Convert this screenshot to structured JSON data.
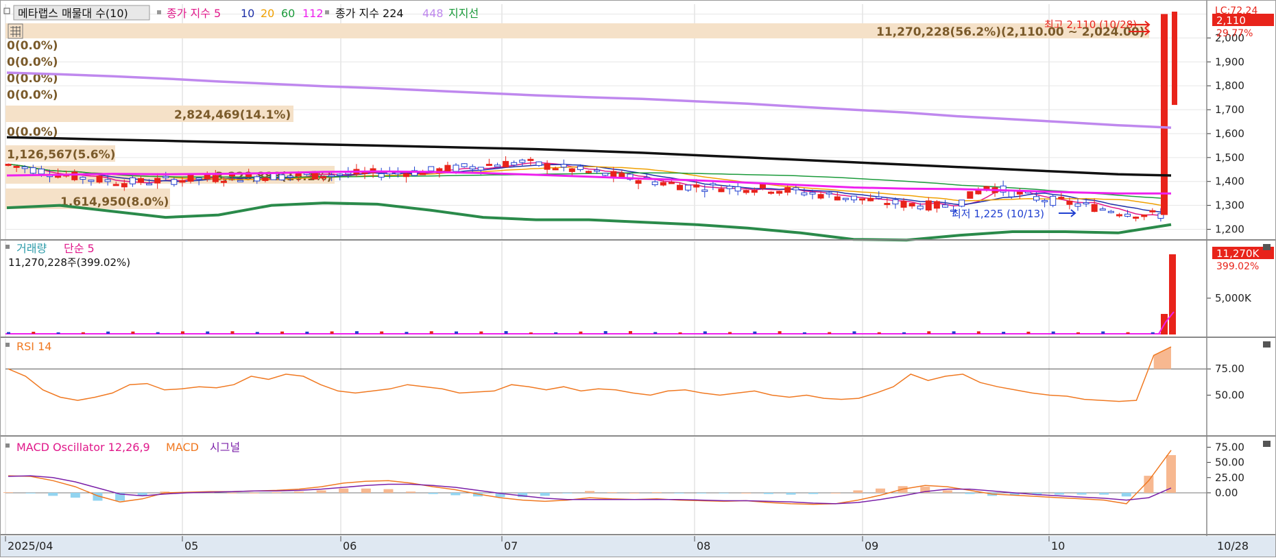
{
  "legend": {
    "stock_name": "메타랩스 매물대 수(10)",
    "ma_group_label": "종가 지수 5",
    "ma_10": "10",
    "ma_20": "20",
    "ma_60": "60",
    "ma_112": "112",
    "ma2_group_label": "종가 지수 224",
    "ma_448": "448",
    "support_line": "지지선",
    "volume_label": "거래량",
    "volume_ma": "단순 5",
    "volume_info": "11,270,228주(399.02%)",
    "rsi_label": "RSI 14",
    "macd_osc_label": "MACD Oscillator 12,26,9",
    "macd_label": "MACD",
    "signal_label": "시그널"
  },
  "annotations": {
    "high_text": "최고 2,110 (10/28)",
    "low_text": "최저 1,225 (10/13)",
    "top_profile": "11,270,228(56.2%)(2,110.00 ~ 2,024.00)",
    "price_box_label": "2,110",
    "change_pct": "29.77%",
    "lc_label": "LC:72.24",
    "vol_box_label": "11,270K",
    "vol_pct": "399.02%"
  },
  "colors": {
    "up": "#e8231a",
    "down": "#1f3fd0",
    "ma5": "#e0188a",
    "ma10": "#1c2fa8",
    "ma20": "#f0a000",
    "ma60": "#1a9a3a",
    "ma112": "#ee20ee",
    "ma224": "#111111",
    "ma448": "#bf88ee",
    "support": "#2a8a4a",
    "rsi": "#f07820",
    "macd": "#f07820",
    "signal": "#7a1fa8",
    "osc_pos": "#f7b890",
    "osc_neg": "#92d4f0",
    "profile": "#f5e1c8"
  },
  "chart_data": [
    {
      "type": "line",
      "panel": "price",
      "x_ticks": [
        "2025/04",
        "05",
        "06",
        "07",
        "08",
        "09",
        "10",
        "10/28"
      ],
      "y_ticks": [
        1200,
        1300,
        1400,
        1500,
        1600,
        1700,
        1800,
        1900,
        2000,
        2100
      ],
      "y_tick_labels": [
        "1,200",
        "1,300",
        "1,400",
        "1,500",
        "1,600",
        "1,700",
        "1,800",
        "1,900",
        "2,000",
        "2,110"
      ],
      "ylim": [
        1170,
        2130
      ],
      "highest": 2110,
      "lowest": 1225,
      "last_close": 2110,
      "change_pct": 29.77,
      "volume_profile": [
        {
          "label": "11,270,228(56.2%)(2,110.00 ~ 2,024.00)",
          "pct": 56.2
        },
        {
          "label": "0(0.0%)",
          "pct": 0.0
        },
        {
          "label": "0(0.0%)",
          "pct": 0.0
        },
        {
          "label": "0(0.0%)",
          "pct": 0.0
        },
        {
          "label": "0(0.0%)",
          "pct": 0.0
        },
        {
          "label": "2,824,469(14.1%)",
          "pct": 14.1
        },
        {
          "label": "0(0.0%)",
          "pct": 0.0
        },
        {
          "label": "1,126,567(5.6%)",
          "pct": 5.6
        },
        {
          "label": "3,228,888(16.1%)",
          "pct": 16.1
        },
        {
          "label": "1,614,950(8.0%)",
          "pct": 8.0
        }
      ],
      "series": [
        {
          "name": "224",
          "values": [
            1585,
            1580,
            1575,
            1570,
            1565,
            1560,
            1555,
            1550,
            1545,
            1540,
            1535,
            1528,
            1520,
            1510,
            1500,
            1490,
            1480,
            1470,
            1460,
            1450,
            1440,
            1430,
            1425
          ]
        },
        {
          "name": "448",
          "values": [
            1855,
            1848,
            1840,
            1830,
            1818,
            1808,
            1798,
            1790,
            1780,
            1770,
            1760,
            1752,
            1745,
            1735,
            1725,
            1712,
            1700,
            1688,
            1672,
            1660,
            1648,
            1635,
            1625
          ]
        },
        {
          "name": "지지선",
          "values": [
            1290,
            1300,
            1275,
            1250,
            1260,
            1300,
            1310,
            1305,
            1280,
            1250,
            1240,
            1240,
            1230,
            1220,
            1205,
            1185,
            1158,
            1155,
            1175,
            1190,
            1190,
            1185,
            1220
          ]
        }
      ]
    },
    {
      "type": "bar",
      "panel": "volume",
      "y_ticks": [
        5000
      ],
      "y_tick_labels": [
        "5,000K"
      ],
      "last_value_k": 11270
    },
    {
      "type": "line",
      "panel": "rsi",
      "y_ticks": [
        50,
        75
      ],
      "y_tick_labels": [
        "50.00",
        "75.00"
      ],
      "ylim": [
        15,
        100
      ],
      "values": [
        75,
        68,
        55,
        48,
        45,
        48,
        52,
        60,
        61,
        55,
        56,
        58,
        57,
        60,
        68,
        65,
        70,
        68,
        60,
        54,
        52,
        54,
        56,
        60,
        58,
        56,
        52,
        53,
        54,
        60,
        58,
        55,
        58,
        54,
        56,
        55,
        52,
        50,
        54,
        55,
        52,
        50,
        52,
        54,
        50,
        48,
        50,
        47,
        46,
        47,
        52,
        58,
        70,
        64,
        68,
        70,
        62,
        58,
        55,
        52,
        50,
        49,
        46,
        45,
        44,
        45,
        88,
        96
      ]
    },
    {
      "type": "line",
      "panel": "macd",
      "y_ticks": [
        0,
        25,
        50,
        75
      ],
      "y_tick_labels": [
        "0.00",
        "25.00",
        "50.00",
        "75.00"
      ],
      "ylim": [
        -35,
        80
      ],
      "macd": [
        28,
        27,
        20,
        10,
        -5,
        -15,
        -10,
        0,
        1,
        2,
        2,
        3,
        4,
        6,
        10,
        16,
        19,
        20,
        16,
        10,
        5,
        -2,
        -8,
        -12,
        -14,
        -12,
        -8,
        -10,
        -11,
        -10,
        -12,
        -13,
        -14,
        -13,
        -16,
        -18,
        -19,
        -18,
        -12,
        -4,
        6,
        12,
        10,
        4,
        -2,
        -4,
        -6,
        -8,
        -10,
        -12,
        -18,
        20,
        70
      ],
      "signal": [
        27,
        28,
        25,
        18,
        8,
        -2,
        -5,
        -2,
        0,
        1,
        2,
        3,
        3,
        4,
        6,
        9,
        12,
        14,
        14,
        12,
        9,
        4,
        -1,
        -5,
        -9,
        -11,
        -11,
        -11,
        -11,
        -11,
        -11,
        -12,
        -13,
        -13,
        -14,
        -15,
        -17,
        -18,
        -16,
        -11,
        -5,
        2,
        6,
        6,
        3,
        0,
        -3,
        -5,
        -7,
        -9,
        -12,
        -8,
        8
      ],
      "oscillator": [
        1,
        -1,
        -5,
        -8,
        -13,
        -13,
        -5,
        2,
        1,
        1,
        0,
        0,
        1,
        2,
        4,
        7,
        7,
        6,
        2,
        -2,
        -4,
        -6,
        -7,
        -7,
        -5,
        -1,
        3,
        1,
        0,
        1,
        -1,
        -1,
        -1,
        0,
        -2,
        -3,
        -2,
        0,
        4,
        7,
        11,
        10,
        4,
        -2,
        -5,
        -4,
        -3,
        -3,
        -3,
        -3,
        -6,
        28,
        62
      ]
    }
  ]
}
